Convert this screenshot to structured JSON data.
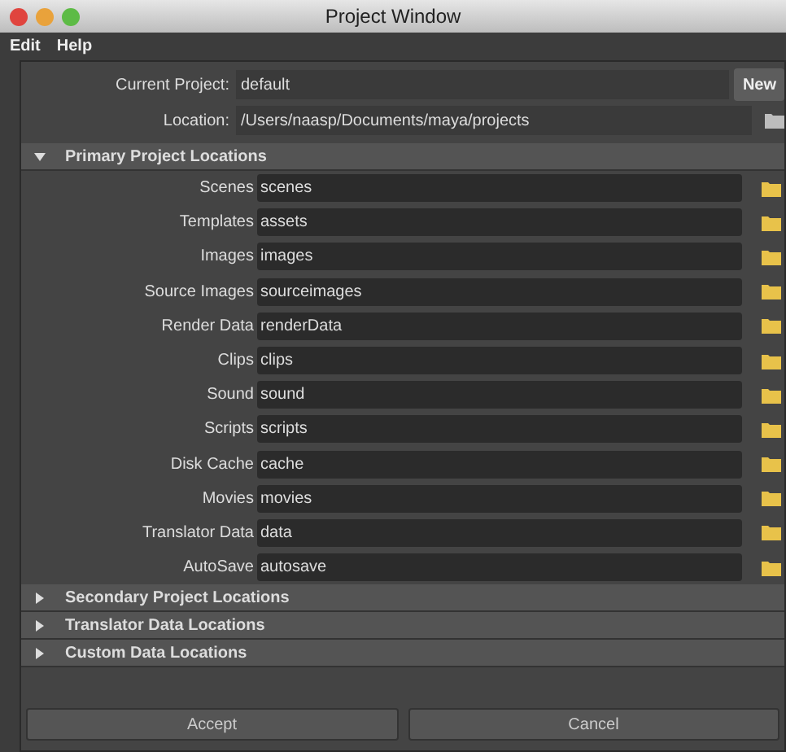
{
  "window": {
    "title": "Project Window"
  },
  "menu": [
    "Edit",
    "Help"
  ],
  "current_project": {
    "label": "Current Project:",
    "value": "default",
    "button": "New"
  },
  "location": {
    "label": "Location:",
    "value": "/Users/naasp/Documents/maya/projects"
  },
  "sections": [
    {
      "title": "Primary Project Locations",
      "expanded": true,
      "rows": [
        {
          "label": "Scenes",
          "value": "scenes"
        },
        {
          "label": "Templates",
          "value": "assets"
        },
        {
          "label": "Images",
          "value": "images"
        },
        {
          "label": "Source Images",
          "value": "sourceimages"
        },
        {
          "label": "Render Data",
          "value": "renderData"
        },
        {
          "label": "Clips",
          "value": "clips"
        },
        {
          "label": "Sound",
          "value": "sound"
        },
        {
          "label": "Scripts",
          "value": "scripts"
        },
        {
          "label": "Disk Cache",
          "value": "cache"
        },
        {
          "label": "Movies",
          "value": "movies"
        },
        {
          "label": "Translator Data",
          "value": "data"
        },
        {
          "label": "AutoSave",
          "value": "autosave"
        }
      ]
    },
    {
      "title": "Secondary Project Locations",
      "expanded": false
    },
    {
      "title": "Translator Data Locations",
      "expanded": false
    },
    {
      "title": "Custom Data Locations",
      "expanded": false
    }
  ],
  "buttons": [
    "Accept",
    "Cancel"
  ]
}
